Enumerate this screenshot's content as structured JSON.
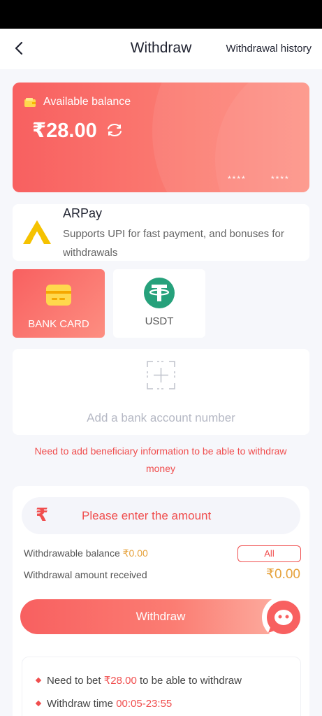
{
  "header": {
    "title": "Withdraw",
    "history_link": "Withdrawal history"
  },
  "balance_card": {
    "label": "Available balance",
    "amount": "₹28.00",
    "masked_1": "****",
    "masked_2": "****"
  },
  "arpay": {
    "name": "ARPay",
    "description": "Supports UPI for fast payment, and bonuses for withdrawals"
  },
  "methods": [
    {
      "label": "BANK CARD",
      "selected": true,
      "icon": "bank-card-icon"
    },
    {
      "label": "USDT",
      "selected": false,
      "icon": "usdt-icon"
    }
  ],
  "add_account": {
    "label": "Add a bank account number"
  },
  "notice": "Need to add beneficiary information to be able to withdraw money",
  "form": {
    "currency_symbol": "₹",
    "amount_placeholder": "Please enter the amount",
    "withdrawable_label": "Withdrawable balance",
    "withdrawable_value": "₹0.00",
    "all_button": "All",
    "received_label": "Withdrawal amount received",
    "received_value": "₹0.00",
    "withdraw_button": "Withdraw"
  },
  "rules": [
    {
      "prefix": "Need to bet ",
      "highlight": "₹28.00",
      "suffix": " to be able to withdraw"
    },
    {
      "prefix": "Withdraw time ",
      "highlight": "00:05-23:55",
      "suffix": ""
    }
  ],
  "colors": {
    "accent": "#f04e4e",
    "gold": "#e6a23c",
    "usdt_green": "#26a17b",
    "arpay_yellow": "#f5c200"
  }
}
